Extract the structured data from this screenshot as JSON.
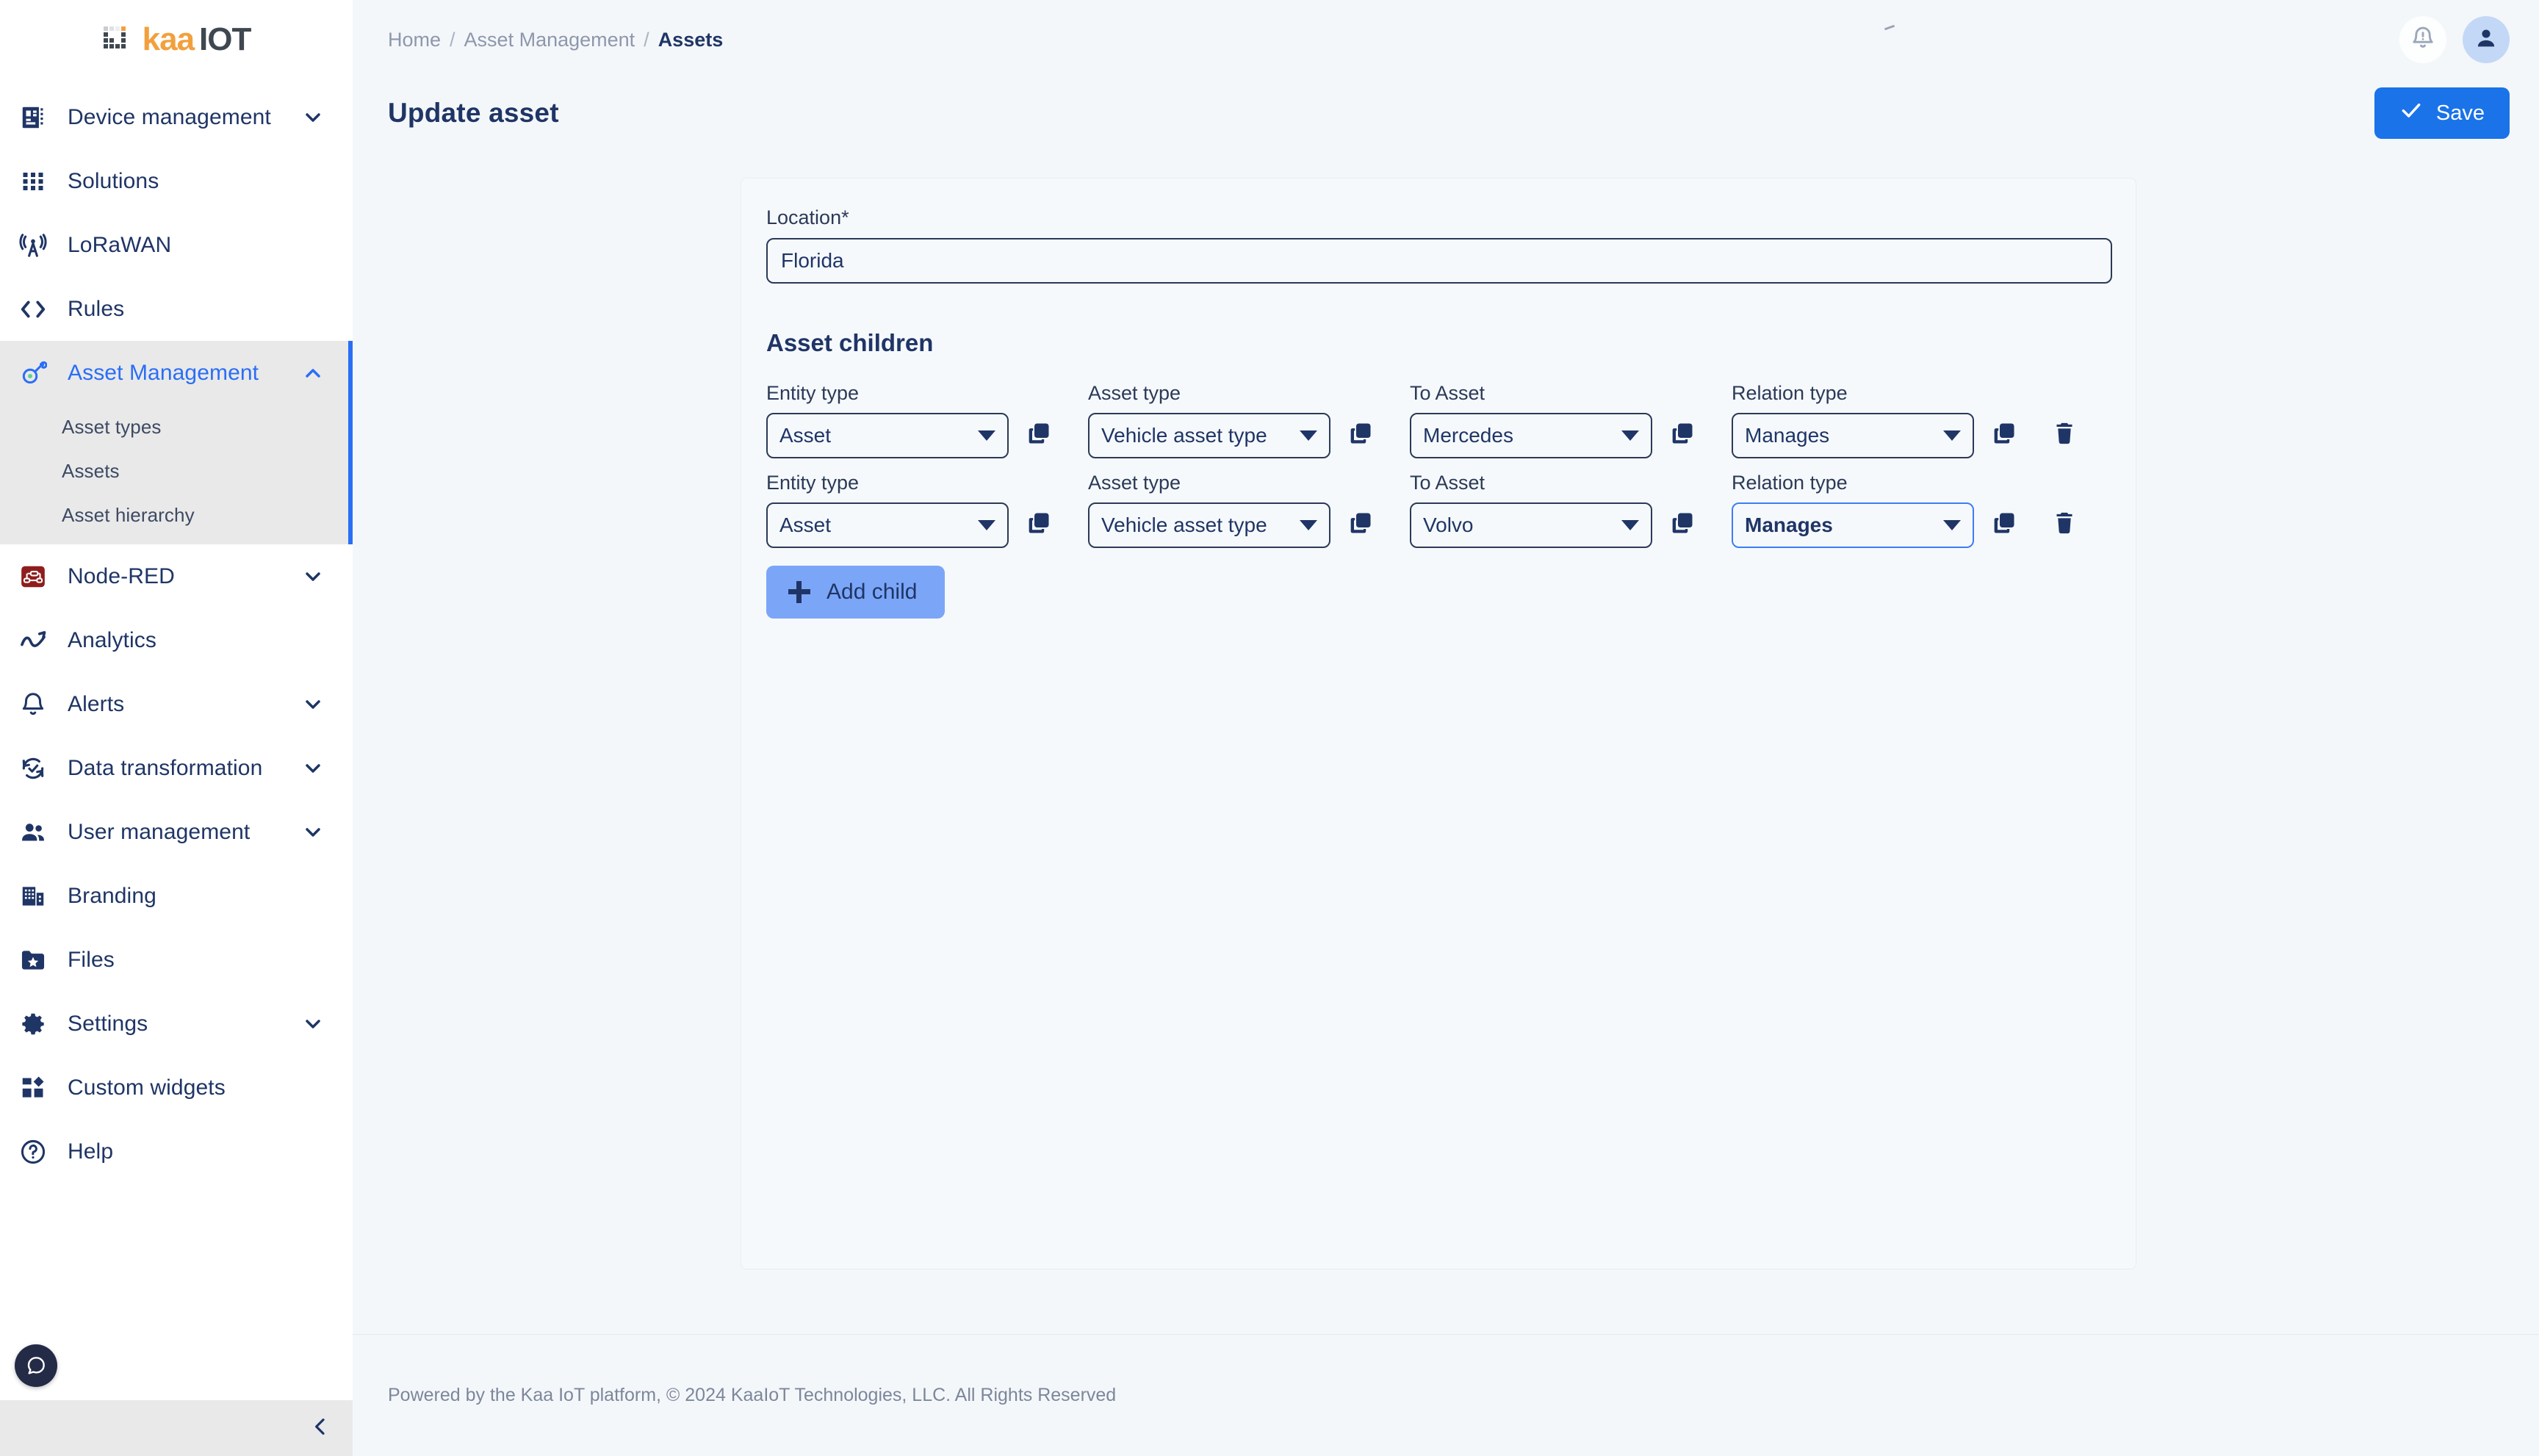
{
  "brand": {
    "logo_kaa": "kaa",
    "logo_iot": "IOT",
    "accent_orange": "#f2a03d",
    "accent_dark": "#3f4750",
    "primary_blue": "#2a6ef5",
    "navy": "#1f3566"
  },
  "sidebar": {
    "items": [
      {
        "label": "Device management",
        "icon": "device-management-icon",
        "expandable": true,
        "expanded": false
      },
      {
        "label": "Solutions",
        "icon": "solutions-grid-icon",
        "expandable": false
      },
      {
        "label": "LoRaWAN",
        "icon": "lorawan-antenna-icon",
        "expandable": false
      },
      {
        "label": "Rules",
        "icon": "rules-code-icon",
        "expandable": false
      },
      {
        "label": "Asset Management",
        "icon": "asset-management-icon",
        "expandable": true,
        "expanded": true,
        "active": true,
        "children": [
          {
            "label": "Asset types"
          },
          {
            "label": "Assets"
          },
          {
            "label": "Asset hierarchy"
          }
        ]
      },
      {
        "label": "Node-RED",
        "icon": "node-red-icon",
        "expandable": true,
        "expanded": false
      },
      {
        "label": "Analytics",
        "icon": "analytics-icon",
        "expandable": false
      },
      {
        "label": "Alerts",
        "icon": "alerts-bell-icon",
        "expandable": true,
        "expanded": false
      },
      {
        "label": "Data transformation",
        "icon": "data-transformation-icon",
        "expandable": true,
        "expanded": false
      },
      {
        "label": "User management",
        "icon": "user-management-icon",
        "expandable": true,
        "expanded": false
      },
      {
        "label": "Branding",
        "icon": "branding-building-icon",
        "expandable": false
      },
      {
        "label": "Files",
        "icon": "files-folder-icon",
        "expandable": false
      },
      {
        "label": "Settings",
        "icon": "settings-gear-icon",
        "expandable": true,
        "expanded": false
      },
      {
        "label": "Custom widgets",
        "icon": "custom-widgets-icon",
        "expandable": false
      },
      {
        "label": "Help",
        "icon": "help-circle-icon",
        "expandable": false
      }
    ],
    "chat_icon": "chat-bubble-icon",
    "collapse_icon": "chevron-left-icon"
  },
  "topbar": {
    "breadcrumb": [
      {
        "label": "Home",
        "current": false
      },
      {
        "label": "Asset Management",
        "current": false
      },
      {
        "label": "Assets",
        "current": true
      }
    ],
    "separator": "/",
    "notifications_icon": "bell-alert-icon",
    "avatar_icon": "user-avatar-icon"
  },
  "page": {
    "title": "Update asset",
    "save_label": "Save",
    "save_icon": "check-icon"
  },
  "form": {
    "location": {
      "label": "Location*",
      "value": "Florida",
      "placeholder": "Location"
    },
    "asset_children": {
      "title": "Asset children",
      "column_labels": {
        "entity_type": "Entity type",
        "asset_type": "Asset type",
        "to_asset": "To Asset",
        "relation_type": "Relation type"
      },
      "copy_icon": "copy-icon",
      "delete_icon": "trash-delete-icon",
      "rows": [
        {
          "entity_type": "Asset",
          "asset_type": "Vehicle asset type",
          "to_asset": "Mercedes",
          "relation_type": "Manages",
          "relation_type_focused": false,
          "has_delete": true
        },
        {
          "entity_type": "Asset",
          "asset_type": "Vehicle asset type",
          "to_asset": "Volvo",
          "relation_type": "Manages",
          "relation_type_focused": true,
          "has_delete": true
        }
      ],
      "add_child_label": "Add child",
      "add_child_icon": "plus-icon"
    }
  },
  "footer": {
    "text": "Powered by the Kaa IoT platform, © 2024 KaaIoT Technologies, LLC. All Rights Reserved"
  }
}
